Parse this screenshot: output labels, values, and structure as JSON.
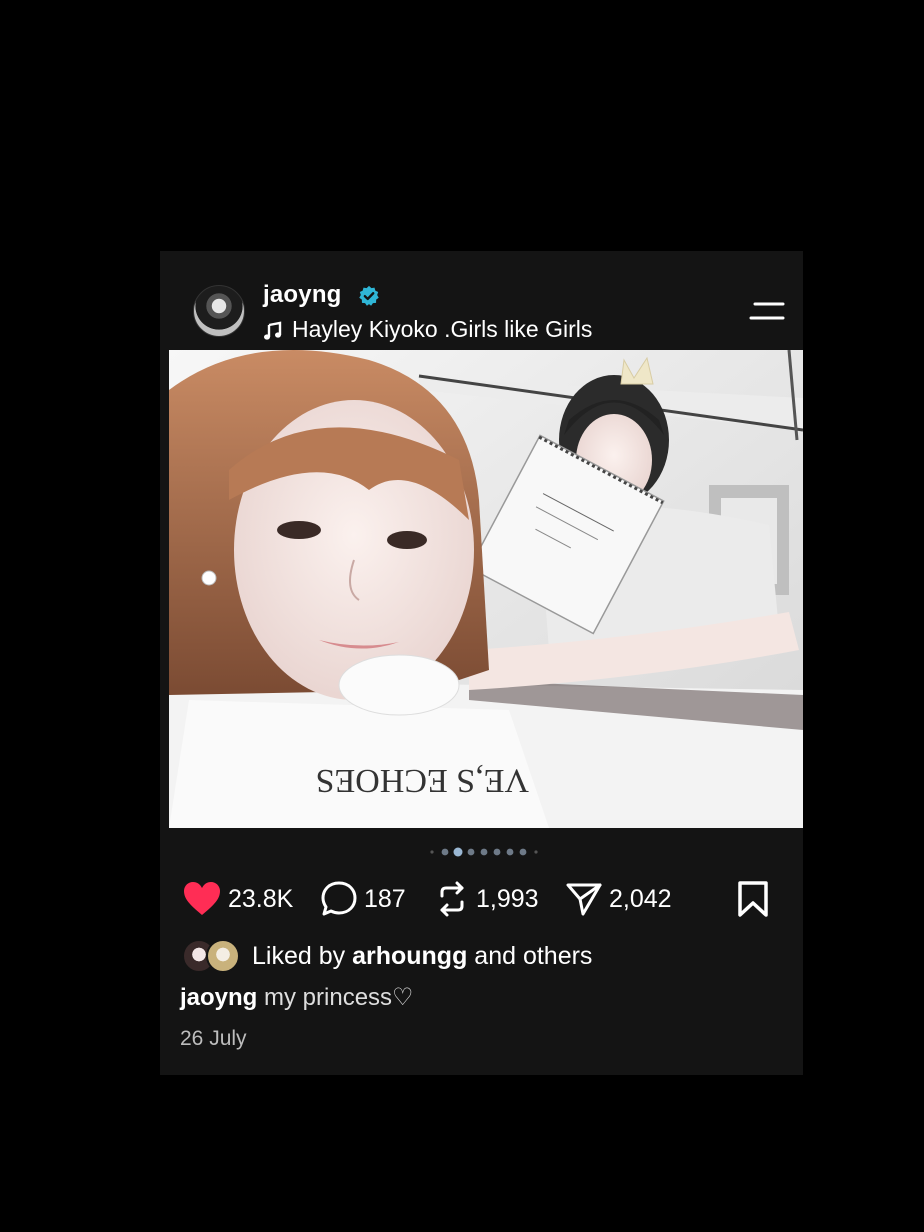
{
  "post": {
    "username": "jaoyng",
    "song": "Hayley Kiyoko .Girls like Girls",
    "photo_carousel": {
      "total": 7,
      "active_index": 1
    },
    "stats": {
      "likes": "23.8K",
      "comments": "187",
      "reposts": "1,993",
      "shares": "2,042"
    },
    "liked_by": {
      "prefix": "Liked by",
      "user": "arhoungg",
      "suffix": "and others"
    },
    "caption": {
      "user": "jaoyng",
      "text": "my princess♡"
    },
    "date": "26 July"
  },
  "colors": {
    "background": "#000000",
    "card": "#141414",
    "verified": "#2fb6d6",
    "like_heart": "#ff2d55",
    "text": "#ffffff",
    "muted": "#bdbdbd"
  },
  "icons": {
    "avatar": "profile-avatar",
    "verified": "verified-badge-icon",
    "music": "music-note-icon",
    "menu": "menu-lines-icon",
    "like": "heart-icon",
    "comment": "comment-bubble-icon",
    "repost": "repost-icon",
    "share": "send-icon",
    "save": "bookmark-icon"
  }
}
